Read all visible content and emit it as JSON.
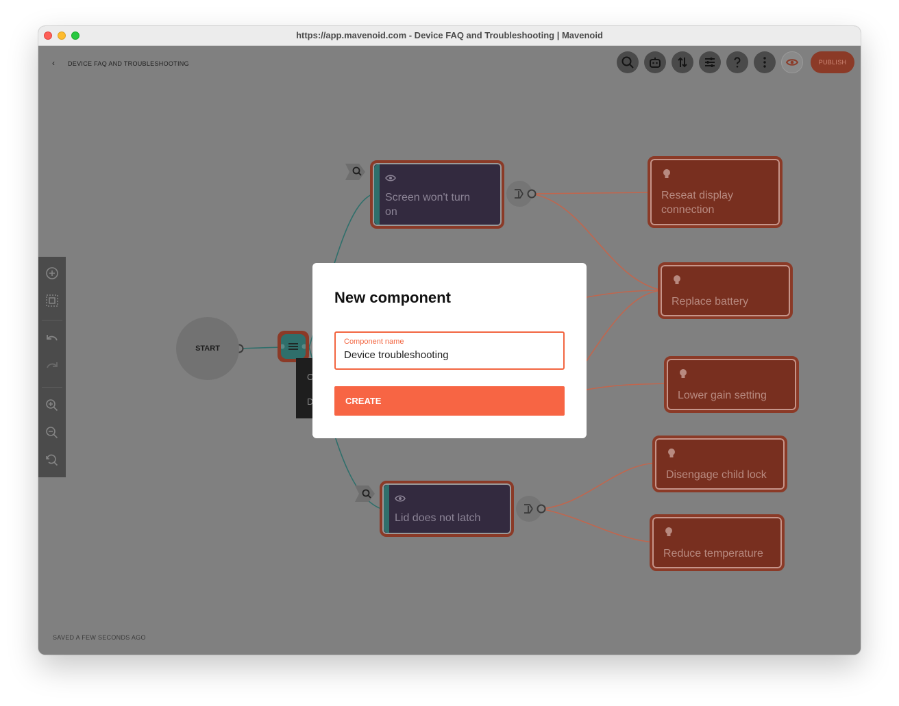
{
  "window": {
    "title": "https://app.mavenoid.com - Device FAQ and Troubleshooting | Mavenoid"
  },
  "header": {
    "breadcrumb": "DEVICE FAQ AND TROUBLESHOOTING",
    "publish_label": "PUBLISH",
    "toolbar_icons": [
      "search-icon",
      "bot-icon",
      "sort-icon",
      "sliders-icon",
      "help-icon",
      "more-icon",
      "preview-eye-icon"
    ]
  },
  "status": {
    "saved": "SAVED A FEW SECONDS AGO"
  },
  "flow": {
    "start_label": "START",
    "questions": [
      {
        "label_line1": "Screen won't turn",
        "label_line2": "on"
      },
      {
        "label_line1": "Lid does not latch",
        "label_line2": ""
      }
    ],
    "solutions": [
      {
        "label_line1": "Reseat display",
        "label_line2": "connection"
      },
      {
        "label_line1": "Replace battery",
        "label_line2": ""
      },
      {
        "label_line1": "Lower gain setting",
        "label_line2": ""
      },
      {
        "label_line1": "Disengage child lock",
        "label_line2": ""
      },
      {
        "label_line1": "Reduce temperature",
        "label_line2": ""
      }
    ],
    "popup_letters": [
      "C",
      "D"
    ]
  },
  "modal": {
    "title": "New component",
    "field_label": "Component name",
    "field_value": "Device troubleshooting",
    "create_label": "CREATE"
  },
  "colors": {
    "accent": "#f76544",
    "canvas": "#808080",
    "question_node": "#332a3f",
    "solution_node": "#782f1f",
    "teal": "#2f6f6b"
  }
}
